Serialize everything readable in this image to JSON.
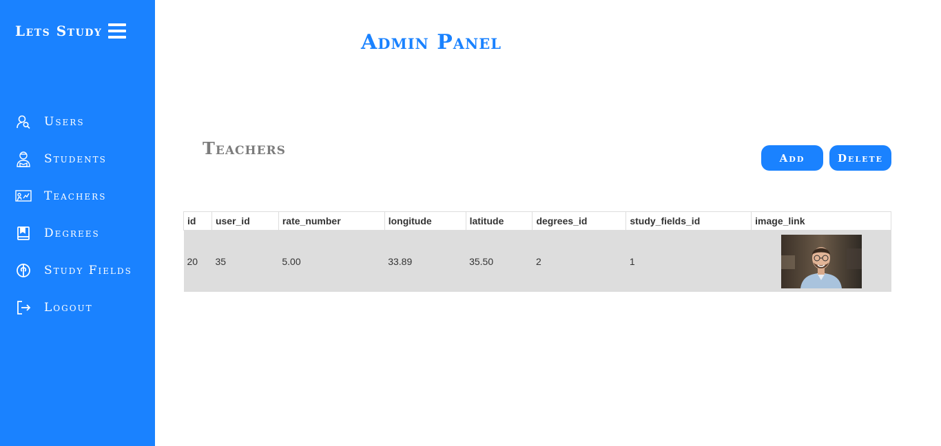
{
  "sidebar": {
    "brand": "Lets Study",
    "items": [
      {
        "label": "Users",
        "icon": "user-search-icon"
      },
      {
        "label": "Students",
        "icon": "student-icon"
      },
      {
        "label": "Teachers",
        "icon": "teacher-board-icon"
      },
      {
        "label": "Degrees",
        "icon": "book-icon"
      },
      {
        "label": "Study Fields",
        "icon": "brain-icon"
      },
      {
        "label": "Logout",
        "icon": "logout-icon"
      }
    ]
  },
  "header": {
    "title": "Admin Panel"
  },
  "section": {
    "title": "Teachers",
    "add_label": "Add",
    "delete_label": "Delete"
  },
  "table": {
    "columns": [
      "id",
      "user_id",
      "rate_number",
      "longitude",
      "latitude",
      "degrees_id",
      "study_fields_id",
      "image_link"
    ],
    "rows": [
      {
        "id": "20",
        "user_id": "35",
        "rate_number": "5.00",
        "longitude": "33.89",
        "latitude": "35.50",
        "degrees_id": "2",
        "study_fields_id": "1",
        "image_link": "teacher-photo"
      }
    ]
  },
  "colors": {
    "accent": "#1a82ff",
    "section_title": "#7c7c7c",
    "row_background": "#dddddd"
  }
}
